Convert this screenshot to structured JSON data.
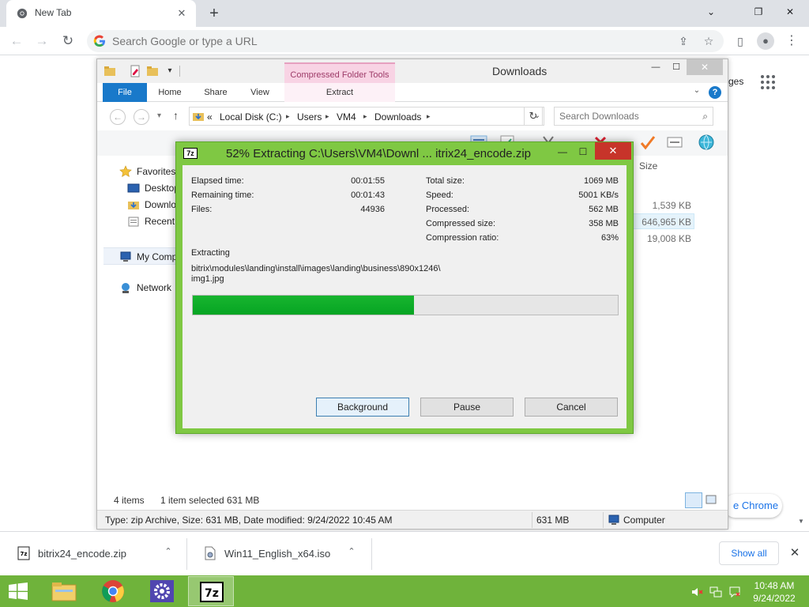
{
  "chrome": {
    "tab_title": "New Tab",
    "tab_close": "✕",
    "new_tab": "+",
    "min": "⌄",
    "restore": "❐",
    "close": "✕",
    "back": "←",
    "forward": "→",
    "reload": "↻",
    "omnibox_placeholder": "Search Google or type a URL",
    "share_icon": "⇪",
    "bookmark_icon": "☆",
    "sidepanel_icon": "▯",
    "profile_icon": "●",
    "menu_icon": "⋮",
    "page_images_fragment": "ges",
    "page_customize_fragment": "e Chrome",
    "page_scroll_down": "▼"
  },
  "explorer": {
    "title": "Downloads",
    "context_tab": "Compressed Folder Tools",
    "ctrl_min": "—",
    "ctrl_max": "☐",
    "ctrl_close": "✕",
    "ribbon_tabs": [
      "File",
      "Home",
      "Share",
      "View"
    ],
    "ribbon_extract": "Extract",
    "ribbon_chevron": "⌄",
    "help": "?",
    "back": "←",
    "forward": "→",
    "recent_drop": "▾",
    "up": "↑",
    "address": {
      "prefix": "«",
      "crumbs": [
        "Local Disk (C:)",
        "Users",
        "VM4",
        "Downloads"
      ],
      "sep": "▸",
      "drop": "⌄"
    },
    "refresh": "↻",
    "search_placeholder": "Search Downloads",
    "search_icon": "⌕",
    "nav": {
      "favorites": "Favorites",
      "desktop": "Desktop",
      "downloads": "Downlo",
      "recent": "Recent p",
      "my_computer": "My Comp",
      "network": "Network"
    },
    "column_size": "Size",
    "sizes": [
      "1,539 KB",
      "646,965 KB",
      "19,008 KB"
    ],
    "status": {
      "items": "4 items",
      "selected": "1 item selected  631 MB"
    },
    "bottombar": {
      "details": "Type: zip Archive, Size: 631 MB, Date modified: 9/24/2022 10:45 AM",
      "size": "631 MB",
      "location": "Computer"
    }
  },
  "zip": {
    "title": "52% Extracting C:\\Users\\VM4\\Downl ... itrix24_encode.zip",
    "logo": "7z",
    "ctrl_min": "—",
    "ctrl_max": "☐",
    "ctrl_close": "✕",
    "elapsed_label": "Elapsed time:",
    "elapsed_value": "00:01:55",
    "remaining_label": "Remaining time:",
    "remaining_value": "00:01:43",
    "files_label": "Files:",
    "files_value": "44936",
    "total_size_label": "Total size:",
    "total_size_value": "1069 MB",
    "speed_label": "Speed:",
    "speed_value": "5001 KB/s",
    "processed_label": "Processed:",
    "processed_value": "562 MB",
    "compressed_label": "Compressed size:",
    "compressed_value": "358 MB",
    "ratio_label": "Compression ratio:",
    "ratio_value": "63%",
    "extracting_label": "Extracting",
    "current_path_line1": "bitrix\\modules\\landing\\install\\images\\landing\\business\\890x1246\\",
    "current_path_line2": "img1.jpg",
    "progress": 0.52,
    "btn_background": "Background",
    "btn_pause": "Pause",
    "btn_cancel": "Cancel"
  },
  "shelf": {
    "items": [
      {
        "name": "bitrix24_encode.zip"
      },
      {
        "name": "Win11_English_x64.iso"
      }
    ],
    "chevron": "⌃",
    "show_all": "Show all",
    "close": "✕"
  },
  "taskbar": {
    "time": "10:48 AM",
    "date": "9/24/2022"
  },
  "colors": {
    "zip_frame": "#7fc843",
    "progress_fill": "#06a523",
    "taskbar": "#6fb33b",
    "file_tab": "#1979ca"
  }
}
